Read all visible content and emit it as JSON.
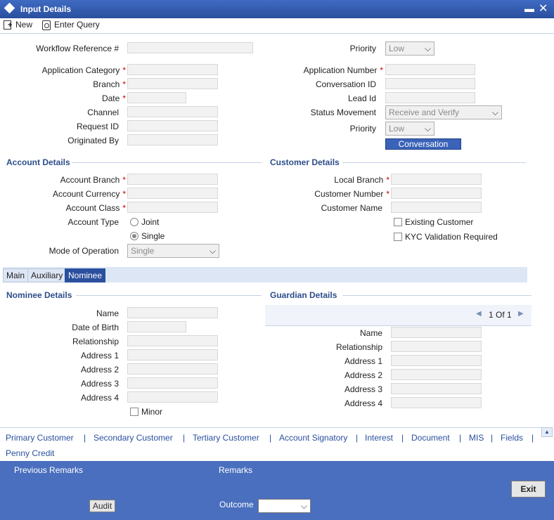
{
  "window": {
    "title": "Input Details"
  },
  "toolbar": {
    "new_label": "New",
    "enter_query_label": "Enter Query"
  },
  "workflow": {
    "workflow_ref_label": "Workflow Reference #",
    "priority_label": "Priority",
    "priority_value": "Low",
    "app_category_label": "Application Category",
    "branch_label": "Branch",
    "date_label": "Date",
    "channel_label": "Channel",
    "request_id_label": "Request ID",
    "originated_by_label": "Originated By",
    "app_number_label": "Application Number",
    "conversation_id_label": "Conversation ID",
    "lead_id_label": "Lead Id",
    "status_movement_label": "Status Movement",
    "status_movement_value": "Receive and Verify",
    "priority2_label": "Priority",
    "priority2_value": "Low",
    "conversation_button": "Conversation"
  },
  "account": {
    "section_title": "Account Details",
    "account_branch_label": "Account Branch",
    "account_currency_label": "Account Currency",
    "account_class_label": "Account Class",
    "account_type_label": "Account Type",
    "joint_label": "Joint",
    "single_label": "Single",
    "mode_of_operation_label": "Mode of Operation",
    "mode_of_operation_value": "Single"
  },
  "customer": {
    "section_title": "Customer Details",
    "local_branch_label": "Local Branch",
    "customer_number_label": "Customer Number",
    "customer_name_label": "Customer Name",
    "existing_customer_label": "Existing Customer",
    "kyc_label": "KYC Validation Required"
  },
  "tabs": [
    {
      "label": "Main"
    },
    {
      "label": "Auxiliary"
    },
    {
      "label": "Nominee"
    }
  ],
  "nominee": {
    "section_title": "Nominee Details",
    "name_label": "Name",
    "dob_label": "Date of Birth",
    "relationship_label": "Relationship",
    "address1_label": "Address 1",
    "address2_label": "Address 2",
    "address3_label": "Address 3",
    "address4_label": "Address 4",
    "minor_label": "Minor"
  },
  "guardian": {
    "section_title": "Guardian Details",
    "pager_text": "1 Of 1",
    "name_label": "Name",
    "relationship_label": "Relationship",
    "address1_label": "Address 1",
    "address2_label": "Address 2",
    "address3_label": "Address 3",
    "address4_label": "Address 4"
  },
  "links": [
    "Primary Customer",
    "Secondary Customer",
    "Tertiary Customer",
    "Account Signatory",
    "Interest",
    "Document",
    "MIS",
    "Fields",
    "Penny Credit"
  ],
  "footer": {
    "previous_remarks_label": "Previous Remarks",
    "remarks_label": "Remarks",
    "audit_label": "Audit",
    "outcome_label": "Outcome",
    "exit_label": "Exit"
  }
}
